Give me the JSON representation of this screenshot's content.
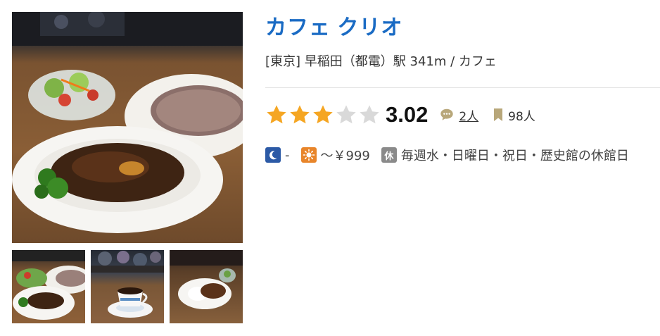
{
  "shop": {
    "name": "カフェ クリオ",
    "area_line": "[東京] 早稲田（都電）駅 341m / カフェ"
  },
  "rating": {
    "stars": 3,
    "max_stars": 5,
    "score": "3.02",
    "reviews": "2人",
    "bookmarks": "98人",
    "star_color": "#f5a623",
    "empty_star_color": "#d9d9d9"
  },
  "budget": {
    "dinner": "-",
    "lunch": "～￥999"
  },
  "holiday": {
    "badge": "休",
    "text": "毎週水・日曜日・祝日・歴史館の休館日"
  },
  "icons": {
    "dinner": "moon-icon",
    "lunch": "sun-icon",
    "review": "speech-bubble-icon",
    "bookmark": "bookmark-icon"
  },
  "colors": {
    "name_link": "#1a6bc4",
    "moon_bg": "#2c5aa6",
    "sun_bg": "#e8852a",
    "holiday_bg": "#8a8a8a"
  }
}
